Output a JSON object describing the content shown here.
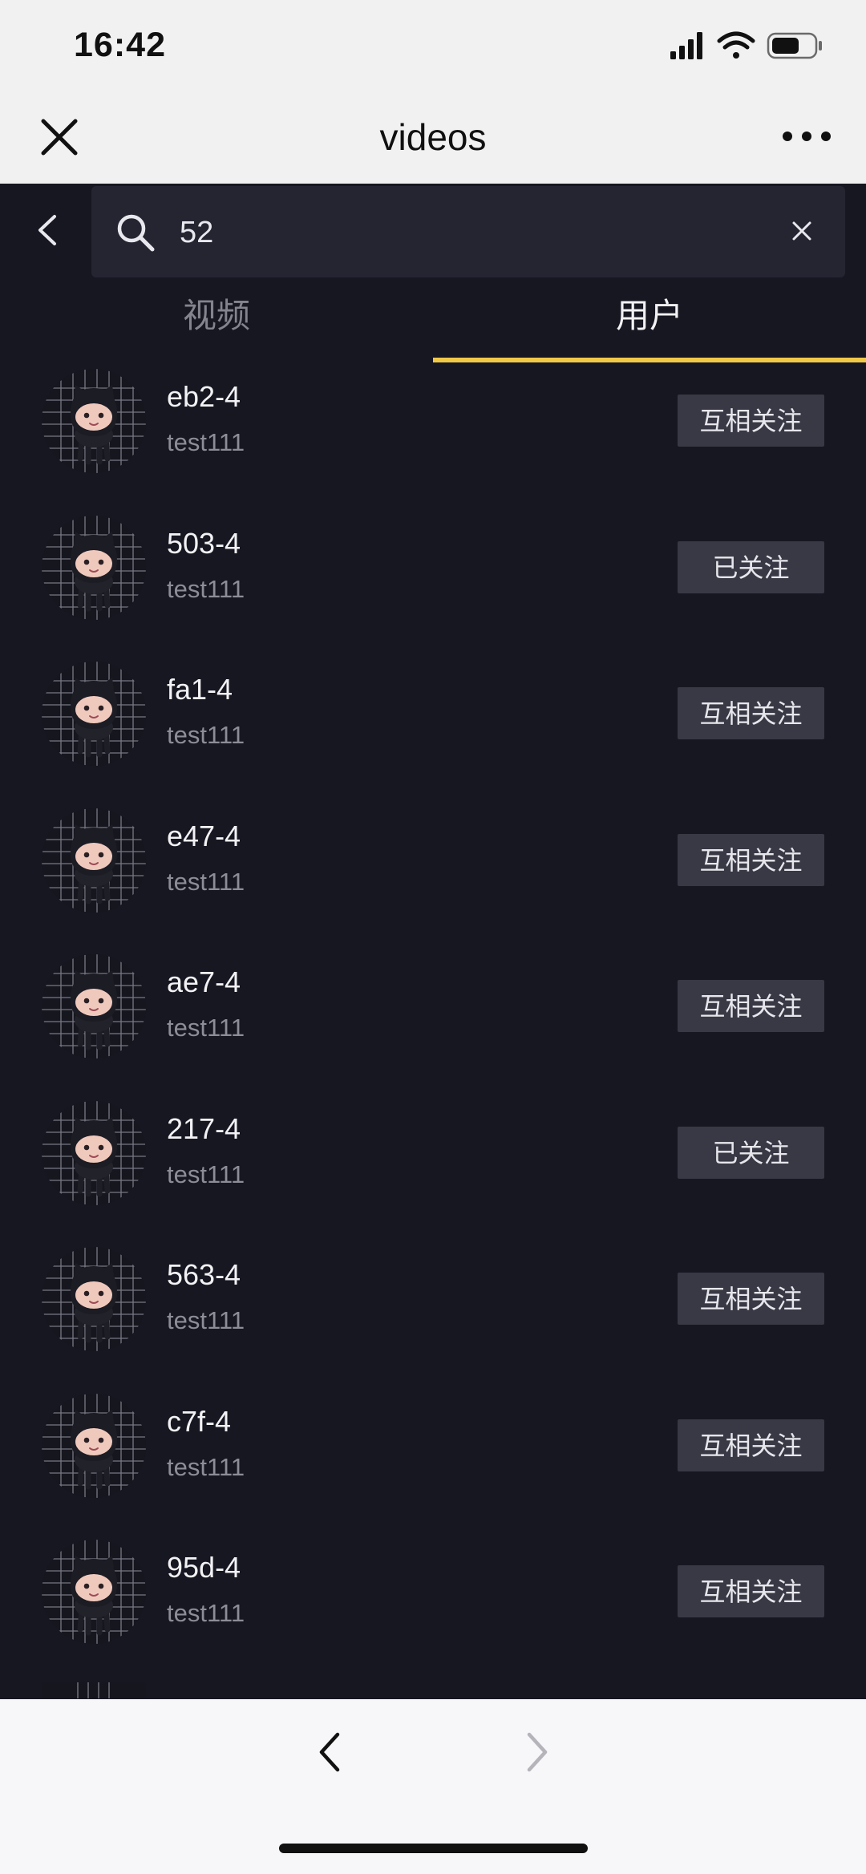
{
  "status_bar": {
    "time": "16:42",
    "battery": "battery-icon",
    "wifi": "wifi-icon",
    "signal": "signal-icon"
  },
  "header": {
    "title": "videos",
    "close_icon": "close-icon",
    "more_icon": "more-icon"
  },
  "search": {
    "value": "52",
    "back_icon": "chevron-left-icon",
    "search_icon": "search-icon",
    "clear_icon": "clear-icon"
  },
  "tabs": [
    {
      "label": "视频",
      "active": false
    },
    {
      "label": "用户",
      "active": true
    }
  ],
  "users": [
    {
      "name": "eb2-4",
      "sub": "test111",
      "button": "互相关注"
    },
    {
      "name": "503-4",
      "sub": "test111",
      "button": "已关注"
    },
    {
      "name": "fa1-4",
      "sub": "test111",
      "button": "互相关注"
    },
    {
      "name": "e47-4",
      "sub": "test111",
      "button": "互相关注"
    },
    {
      "name": "ae7-4",
      "sub": "test111",
      "button": "互相关注"
    },
    {
      "name": "217-4",
      "sub": "test111",
      "button": "已关注"
    },
    {
      "name": "563-4",
      "sub": "test111",
      "button": "互相关注"
    },
    {
      "name": "c7f-4",
      "sub": "test111",
      "button": "互相关注"
    },
    {
      "name": "95d-4",
      "sub": "test111",
      "button": "互相关注"
    }
  ],
  "bottom_nav": {
    "back_icon": "chevron-left-icon",
    "forward_icon": "chevron-right-icon"
  },
  "colors": {
    "background": "#171722",
    "tab_accent": "#f0c948",
    "button_bg": "#393945"
  }
}
